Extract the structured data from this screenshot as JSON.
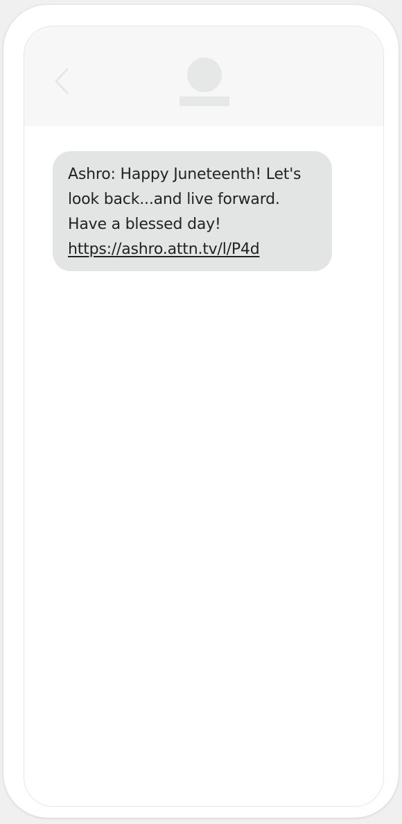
{
  "conversation": {
    "header": {
      "back_icon": "chevron-left-icon",
      "avatar_icon": "contact-avatar-placeholder"
    },
    "messages": [
      {
        "sender": "Ashro",
        "text": "Ashro: Happy Juneteenth! Let's look back...and live forward. Have a blessed day!",
        "link": "https://ashro.attn.tv/l/P4d"
      }
    ]
  },
  "colors": {
    "header_bg": "#f7f7f7",
    "bubble_bg": "#e3e4e4",
    "text": "#222222",
    "placeholder": "#e6e7e7"
  }
}
